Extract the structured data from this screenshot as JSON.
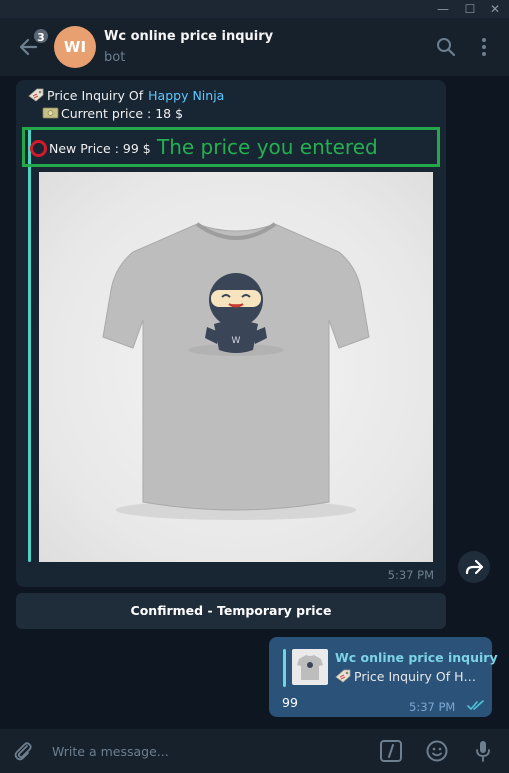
{
  "window": {
    "minimize": "—",
    "maximize": "☐",
    "close": "✕"
  },
  "header": {
    "unread_count": "3",
    "avatar_initials": "WI",
    "avatar_color": "#e8a071",
    "title": "Wc online price inquiry",
    "subtitle": "bot"
  },
  "message_in": {
    "line1_prefix": "Price Inquiry Of",
    "product_name": "Happy Ninja",
    "line2": "Current price : 18 $",
    "new_price": "New Price : 99 $",
    "annotation": "The price you entered",
    "photo_icon": "ninja-tshirt",
    "time": "5:37 PM"
  },
  "keyboard_button": {
    "label": "Confirmed - Temporary price"
  },
  "message_out": {
    "reply_title": "Wc online price inquiry",
    "reply_text": "Price Inquiry Of  Ha...",
    "text": "99",
    "time": "5:37 PM",
    "status": "read"
  },
  "input": {
    "placeholder": "Write a message..."
  },
  "colors": {
    "background": "#0e1621",
    "header": "#17212b",
    "incoming": "#182533",
    "outgoing": "#2b5278",
    "accent": "#5ec8ff",
    "highlight_green": "#23a84a",
    "ring_red": "#d3192b"
  }
}
